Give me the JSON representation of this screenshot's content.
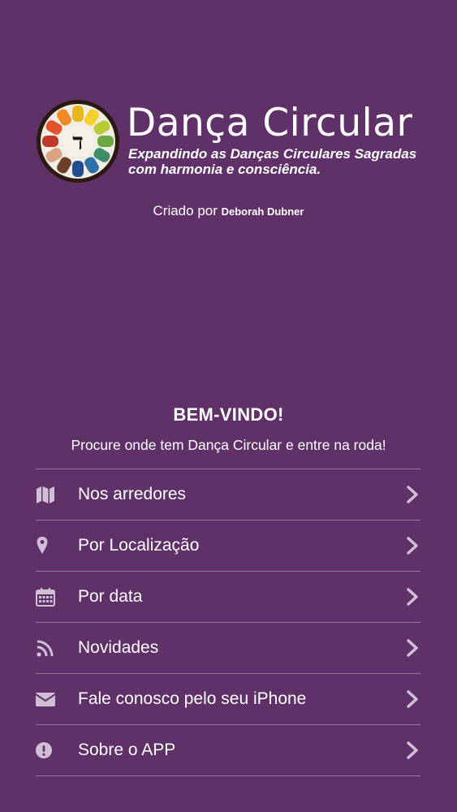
{
  "header": {
    "title": "Dança Circular",
    "tagline_line1": "Expandindo as Danças Circulares Sagradas",
    "tagline_line2": "com harmonia e consciência.",
    "emblem_letter": "ד",
    "credit_prefix": "Criado por",
    "credit_author": "Deborah Dubner"
  },
  "welcome": {
    "title": "BEM-VINDO!",
    "subtitle": "Procure onde tem Dança Circular e entre na roda!"
  },
  "menu": {
    "items": [
      {
        "label": "Nos arredores",
        "icon": "map-icon"
      },
      {
        "label": "Por Localização",
        "icon": "location-pin-icon"
      },
      {
        "label": "Por data",
        "icon": "calendar-icon"
      },
      {
        "label": "Novidades",
        "icon": "rss-icon"
      },
      {
        "label": "Fale conosco pelo seu iPhone",
        "icon": "envelope-icon"
      },
      {
        "label": "Sobre o APP",
        "icon": "info-exclamation-icon"
      }
    ]
  },
  "colors": {
    "background": "#5f3168",
    "icon": "#cfc0d6",
    "divider": "rgba(255,255,255,0.35)"
  }
}
